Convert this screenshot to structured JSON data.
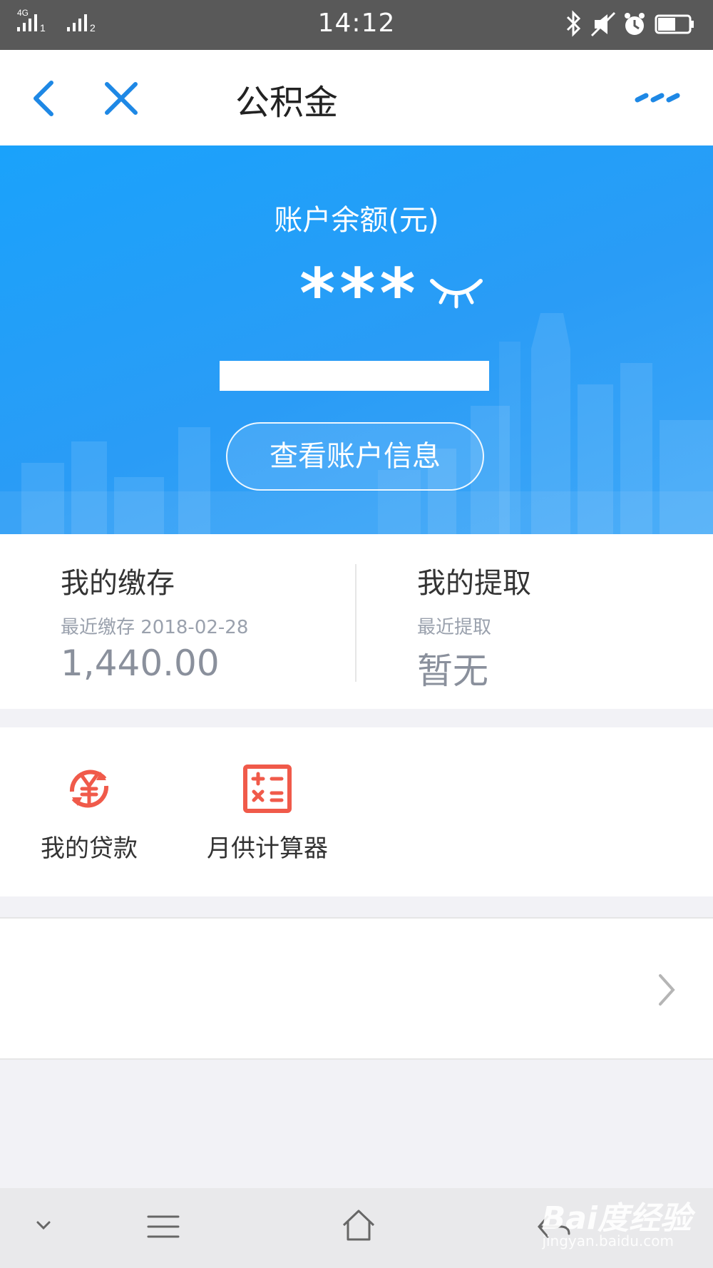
{
  "status_bar": {
    "time": "14:12",
    "signal_label": "4G",
    "sim1": "1",
    "sim2": "2",
    "icons": [
      "bluetooth-icon",
      "mute-icon",
      "alarm-icon",
      "battery-icon"
    ]
  },
  "nav": {
    "title": "公积金",
    "icons": [
      "back-icon",
      "close-icon",
      "more-icon"
    ],
    "accent_color": "#1e88e5"
  },
  "hero": {
    "label": "账户余额(元)",
    "amount": "***",
    "eye_icon": "eye-closed-icon",
    "button_label": "查看账户信息",
    "gradient": [
      "#1aa2fb",
      "#3ea7f8"
    ]
  },
  "stats": {
    "deposit": {
      "title": "我的缴存",
      "sub": "最近缴存 2018-02-28",
      "value": "1,440.00"
    },
    "withdraw": {
      "title": "我的提取",
      "sub": "最近提取",
      "value": "暂无"
    }
  },
  "tools": {
    "items": [
      {
        "label": "我的贷款",
        "icon": "yuan-loan-icon"
      },
      {
        "label": "月供计算器",
        "icon": "calculator-icon"
      }
    ],
    "icon_color": "#f05a4a"
  },
  "bottom_bar": {
    "icons": [
      "collapse-icon",
      "menu-icon",
      "home-icon",
      "back-icon"
    ],
    "watermark": "Bai度经验",
    "watermark_sub": "jingyan.baidu.com"
  }
}
